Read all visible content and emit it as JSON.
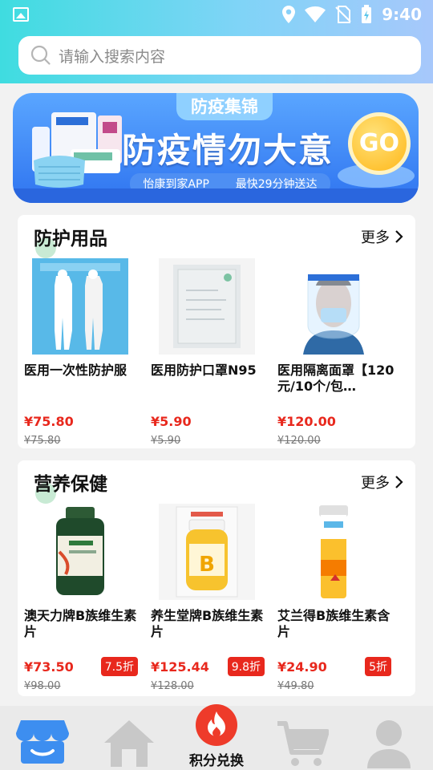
{
  "status_bar": {
    "time": "9:40",
    "icons": [
      "gallery-icon",
      "location-icon",
      "wifi-icon",
      "no-sim-icon",
      "battery-icon"
    ]
  },
  "search": {
    "placeholder": "请输入搜索内容"
  },
  "banner": {
    "tab_title": "防疫集锦",
    "slogan": "防疫情勿大意",
    "go_label": "GO",
    "tag_left": "怡康到家APP",
    "tag_right": "最快29分钟送达"
  },
  "sections": [
    {
      "title": "防护用品",
      "more_label": "更多",
      "items": [
        {
          "name": "医用一次性防护服",
          "price": "¥75.80",
          "original": "¥75.80",
          "discount": ""
        },
        {
          "name": "医用防护口罩N95",
          "price": "¥5.90",
          "original": "¥5.90",
          "discount": ""
        },
        {
          "name": "医用隔离面罩【120元/10个/包…",
          "price": "¥120.00",
          "original": "¥120.00",
          "discount": ""
        }
      ]
    },
    {
      "title": "营养保健",
      "more_label": "更多",
      "items": [
        {
          "name": "澳天力牌B族维生素片",
          "price": "¥73.50",
          "original": "¥98.00",
          "discount": "7.5折"
        },
        {
          "name": "养生堂牌B族维生素片",
          "price": "¥125.44",
          "original": "¥128.00",
          "discount": "9.8折"
        },
        {
          "name": "艾兰得B族维生素含片",
          "price": "¥24.90",
          "original": "¥49.80",
          "discount": "5折"
        }
      ]
    }
  ],
  "bottom_nav": {
    "tabs": [
      {
        "icon": "store-icon",
        "label": ""
      },
      {
        "icon": "home-icon",
        "label": ""
      },
      {
        "icon": "fire-icon",
        "label": "积分兑换"
      },
      {
        "icon": "cart-icon",
        "label": ""
      },
      {
        "icon": "profile-icon",
        "label": ""
      }
    ]
  },
  "colors": {
    "header_start": "#3fdce0",
    "header_end": "#a7c8fb",
    "price_red": "#e8281d",
    "banner_blue": "#2f74f0",
    "nav_blue": "#3d8ef0"
  }
}
